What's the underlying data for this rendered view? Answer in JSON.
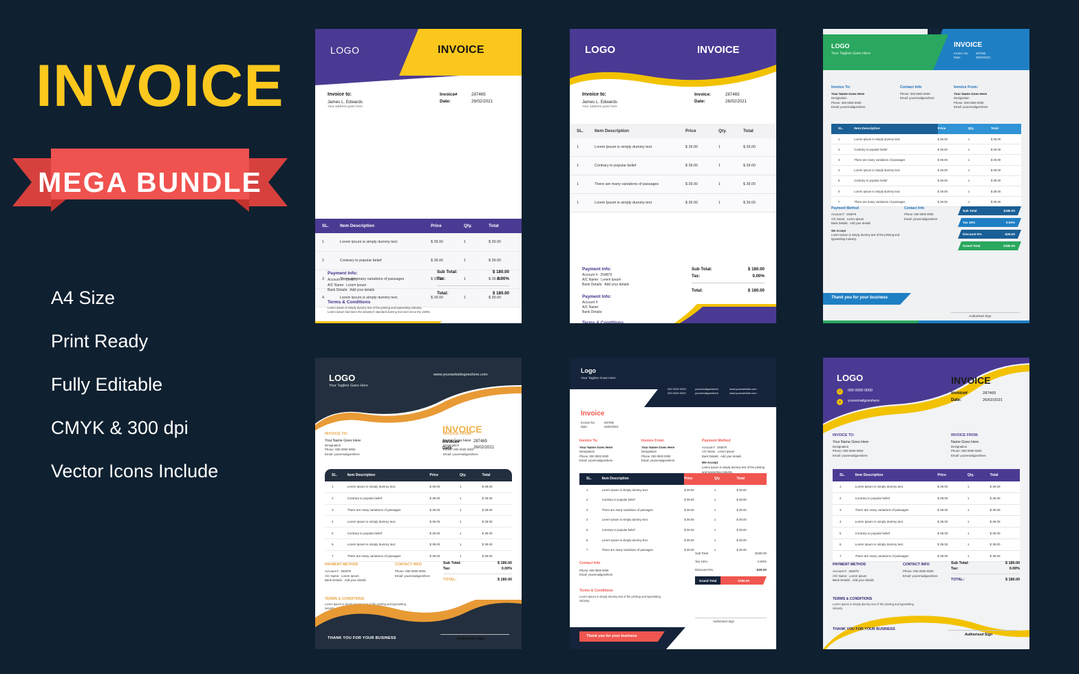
{
  "promo": {
    "title": "INVOICE",
    "ribbon": "MEGA BUNDLE",
    "features": [
      "A4 Size",
      "Print Ready",
      "Fully Editable",
      "CMYK & 300 dpi",
      "Vector Icons Include"
    ],
    "colors": {
      "background": "#0f2030",
      "title": "#fcc81e",
      "ribbon": "#f0524f"
    }
  },
  "common": {
    "logo": "LOGO",
    "logo_title": "Logo",
    "tagline": "Your Tagline Goes Here",
    "invoice_word": "INVOICE",
    "invoice_word_cap": "Invoice",
    "website": "www.yourwebsitegoeshere.com",
    "invoice_number": "287465",
    "date_value": "26/02/2021",
    "label_invoice_hash": "Invoice#",
    "label_invoice_colon": "Invoice:",
    "label_invoice_no": "Invoice No:",
    "label_date": "Date:",
    "columns": [
      "SL.",
      "Item Description",
      "Price",
      "Qty.",
      "Total"
    ],
    "columns_noqty": [
      "SL.",
      "Item Description",
      "Price",
      "Qty",
      "Total"
    ],
    "rows7": [
      {
        "sl": "1",
        "desc": "Lorem Ipsum is simply dummy text.",
        "price": "$ 39.00",
        "qty": "1",
        "total": "$ 39.00"
      },
      {
        "sl": "2",
        "desc": "Contrary to popular belief",
        "price": "$ 39.00",
        "qty": "1",
        "total": "$ 39.00"
      },
      {
        "sl": "3",
        "desc": "There are many variations of passages",
        "price": "$ 39.00",
        "qty": "1",
        "total": "$ 39.00"
      },
      {
        "sl": "4",
        "desc": "Lorem Ipsum is simply dummy text.",
        "price": "$ 39.00",
        "qty": "1",
        "total": "$ 39.00"
      },
      {
        "sl": "5",
        "desc": "Contrary to popular belief",
        "price": "$ 39.00",
        "qty": "1",
        "total": "$ 39.00"
      },
      {
        "sl": "6",
        "desc": "Lorem Ipsum is simply dummy text.",
        "price": "$ 39.00",
        "qty": "1",
        "total": "$ 39.00"
      },
      {
        "sl": "7",
        "desc": "There are many variations of passages",
        "price": "$ 39.00",
        "qty": "1",
        "total": "$ 39.00"
      }
    ],
    "rows4": [
      {
        "sl": "1",
        "desc": "Lorem Ipsum is simply dummy text.",
        "price": "$ 39.00",
        "qty": "1",
        "total": "$ 39.00"
      },
      {
        "sl": "2",
        "desc": "Contrary to popular belief",
        "price": "$ 39.00",
        "qty": "1",
        "total": "$ 39.00"
      },
      {
        "sl": "3",
        "desc": "There are many variations of passages",
        "price": "$ 39.00",
        "qty": "1",
        "total": "$ 39.00"
      },
      {
        "sl": "4",
        "desc": "Lorem Ipsum is simply dummy text.",
        "price": "$ 39.00",
        "qty": "1",
        "total": "$ 39.00"
      }
    ],
    "rows4_alt": [
      {
        "sl": "1",
        "desc": "Lorem Ipsum is simply dummy text.",
        "price": "$ 39.00",
        "qty": "1",
        "total": "$ 39.00"
      },
      {
        "sl": "1",
        "desc": "Contrary to popular belief",
        "price": "$ 39.00",
        "qty": "1",
        "total": "$ 39.00"
      },
      {
        "sl": "1",
        "desc": "There are many variations of passages",
        "price": "$ 39.00",
        "qty": "1",
        "total": "$ 39.00"
      },
      {
        "sl": "1",
        "desc": "Lorem Ipsum is simply dummy text.",
        "price": "$ 39.00",
        "qty": "1",
        "total": "$ 39.00"
      }
    ],
    "invoice_to": "Invoice to:",
    "invoice_to_caps": "INVOICE TO:",
    "invoice_to_title": "Invoice To:",
    "invoice_from_caps": "INVOICE FROM:",
    "invoice_from_title": "Invoice From:",
    "contact_info": "Contact Info",
    "contact_info_caps": "CONTACT INFO",
    "payment_info": "Payment Info:",
    "payment_method": "Payment Method",
    "payment_method_caps": "PAYMENT METHOD",
    "client_name": "James L. Edwards",
    "client_address": "Your address goes here",
    "name_goes_here": "Your Name Goes Here",
    "name_goes_here2": "Name Goes Here",
    "designation": "Designation",
    "phone_line": "Phone: 000 0000 0000",
    "email_line": "Email: youremailgoeshere",
    "phone_plain": "000 0000 0000",
    "email_plain": "youremailgoeshere",
    "website_plain": "www.yourwebsite.com",
    "acct_label": "Account #:",
    "acct_value": "254879",
    "acname_label": "A/C Name:",
    "acname_value": "Lorem Ipsum",
    "bank_label": "Bank Details:",
    "bank_value": "Add your details",
    "we_accept": "We Accept",
    "we_accept_text": "Lorem Ipsum is simply dummy text of the printing and typesetting industry.",
    "terms": "Terms & Conditions",
    "terms_caps": "TERMS & CONDITIONS",
    "terms_text_long": "Lorem Ipsum is simply dummy text of the printing and typesetting industry. Lorem Ipsum has been the industry's standard dummy text ever since the 1500s.",
    "terms_text": "Lorem Ipsum is simply dummy text of the printing and typesetting industry.",
    "sub_total": "Sub Total:",
    "sub_total_plain": "Sub Total",
    "tax": "Tax:",
    "tax15": "Tax 15%",
    "tax15_colon": "Tax 15%:",
    "discount5": "Discount 5%",
    "discount5_colon": "Discount 5%:",
    "total_label": "Total:",
    "total_caps": "TOTAL:",
    "grand_total": "Grand Total",
    "amount": "$ 180.00",
    "amount_tight": "$180.00",
    "tax_value": "0.00%",
    "discount_value": "-$29.00",
    "thanks": "Thank you for your business",
    "thanks_caps": "THANK YOU FOR YOUR BUSINESS",
    "authorised": "Authorised Sign"
  },
  "templates": {
    "t1": {
      "accent": "#4b3a93",
      "secondary": "#fbc71c"
    },
    "t2": {
      "accent": "#4b3a93",
      "secondary": "#f2c200"
    },
    "t3": {
      "accent": "#1f7fc4",
      "secondary": "#2aa85f"
    },
    "t4": {
      "accent": "#232f3e",
      "secondary": "#e7a23f"
    },
    "t5": {
      "accent": "#15243a",
      "secondary": "#f0564f"
    },
    "t6": {
      "accent": "#4b3a93",
      "secondary": "#f2c200"
    }
  },
  "icons": {
    "phone": "phone-icon",
    "email": "email-icon",
    "web": "globe-icon"
  }
}
